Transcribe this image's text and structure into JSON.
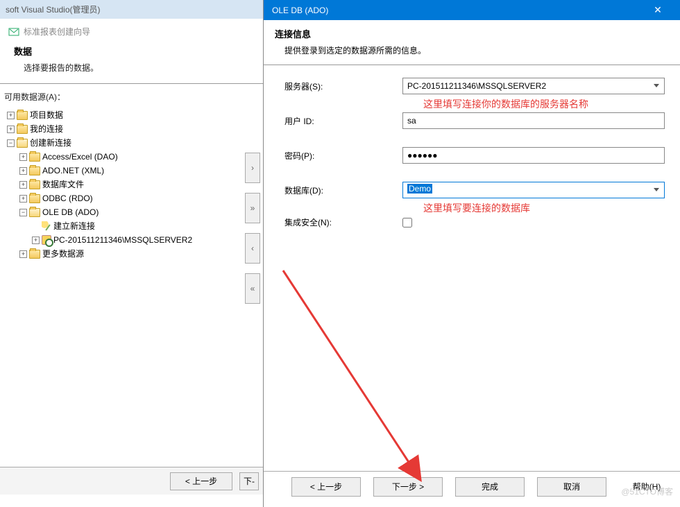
{
  "vs": {
    "title": "soft Visual Studio(管理员)"
  },
  "wizard": {
    "title": "标准报表创建向导",
    "section": "数据",
    "desc": "选择要报告的数据。",
    "treelabel": "可用数据源(A)：",
    "nodes": {
      "proj": "项目数据",
      "myconn": "我的连接",
      "newconn": "创建新连接",
      "access": "Access/Excel (DAO)",
      "adonet": "ADO.NET (XML)",
      "dbfile": "数据库文件",
      "odbc": "ODBC (RDO)",
      "oledb": "OLE DB (ADO)",
      "newlink": "建立新连接",
      "server": "PC-201511211346\\MSSQLSERVER2",
      "more": "更多数据源"
    },
    "prev": "< 上一步",
    "next": "下-"
  },
  "dialog": {
    "title": "OLE DB (ADO)",
    "heading": "连接信息",
    "desc": "提供登录到选定的数据源所需的信息。",
    "labels": {
      "server": "服务器(S):",
      "user": "用户 ID:",
      "password": "密码(P):",
      "database": "数据库(D):",
      "integrated": "集成安全(N):"
    },
    "values": {
      "server": "PC-201511211346\\MSSQLSERVER2",
      "user": "sa",
      "password": "●●●●●●",
      "database": "Demo"
    },
    "hints": {
      "server": "这里填写连接你的数据库的服务器名称",
      "database": "这里填写要连接的数据库"
    },
    "buttons": {
      "prev": "< 上一步",
      "next": "下一步 >",
      "finish": "完成",
      "cancel": "取消",
      "help": "帮助(H)"
    }
  },
  "watermark": "@51CTO博客"
}
